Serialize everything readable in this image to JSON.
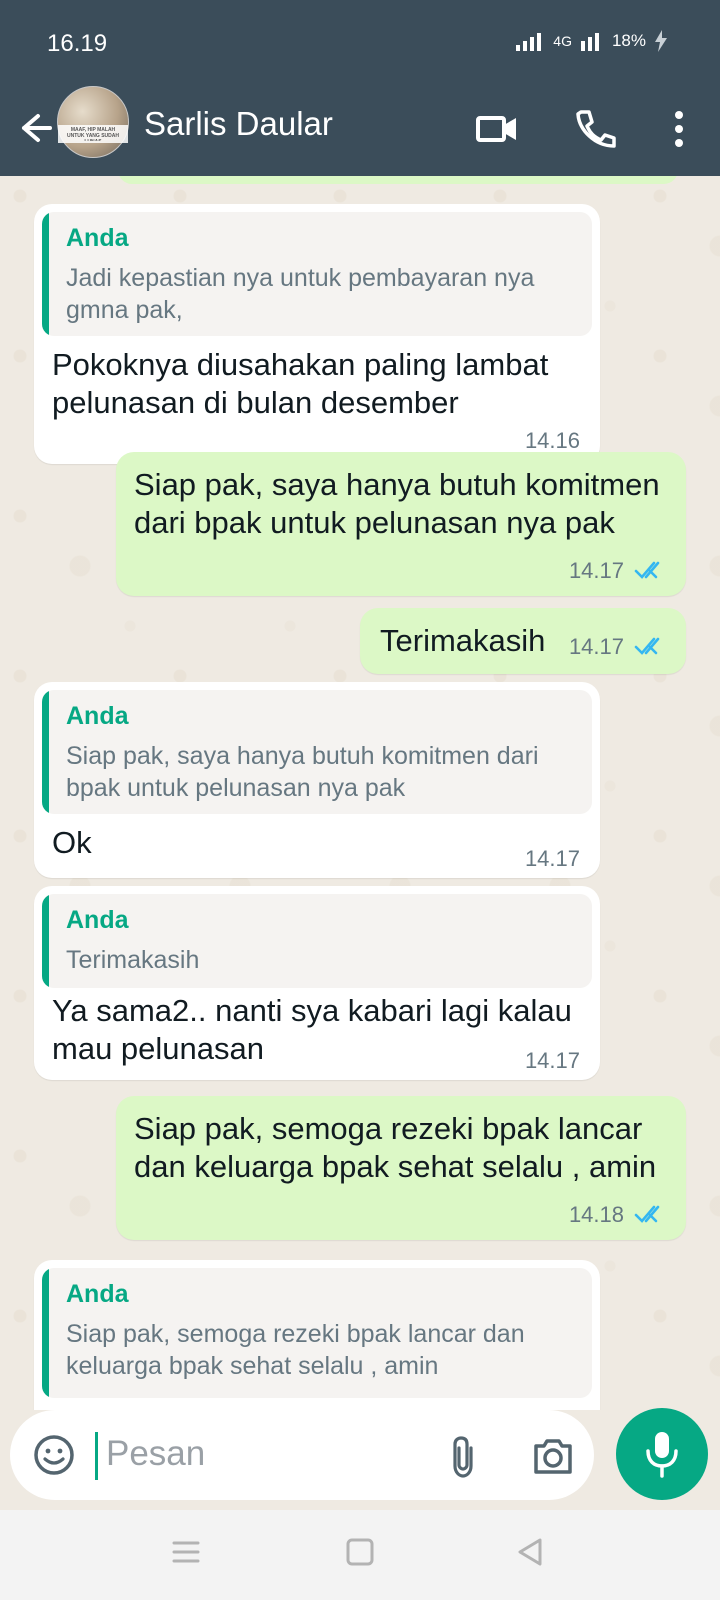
{
  "status": {
    "time": "16.19",
    "network": "4G",
    "battery": "18%"
  },
  "header": {
    "contact_name": "Sarlis Daular",
    "avatar_caption": "MAAF, HIP MALAH UNTUK YANG SUDAH LUNAS"
  },
  "messages": [
    {
      "reply_author": "Anda",
      "reply_text": "Jadi kepastian nya untuk pembayaran nya gmna pak,",
      "text": "Pokoknya diusahakan paling lambat pelunasan di bulan  desember",
      "time": "14.16"
    },
    {
      "text": "Siap pak, saya hanya butuh komitmen dari bpak untuk pelunasan nya pak",
      "time": "14.17"
    },
    {
      "text": "Terimakasih",
      "time": "14.17"
    },
    {
      "reply_author": "Anda",
      "reply_text": "Siap pak, saya hanya butuh komitmen dari bpak untuk pelunasan nya pak",
      "text": "Ok",
      "time": "14.17"
    },
    {
      "reply_author": "Anda",
      "reply_text": "Terimakasih",
      "text": "Ya sama2.. nanti sya kabari lagi kalau mau pelunasan",
      "time": "14.17"
    },
    {
      "text": "Siap pak, semoga rezeki bpak lancar dan keluarga bpak sehat selalu , amin",
      "time": "14.18"
    },
    {
      "reply_author": "Anda",
      "reply_text": "Siap pak, semoga rezeki bpak lancar dan keluarga bpak sehat selalu , amin"
    }
  ],
  "composer": {
    "placeholder": "Pesan"
  },
  "colors": {
    "header": "#3b4d5a",
    "accent": "#06a884",
    "outgoing_bubble": "#dcf8c6",
    "incoming_bubble": "#ffffff",
    "read_ticks": "#34b7f1"
  },
  "icons": {
    "back": "arrow-left-icon",
    "video": "video-icon",
    "call": "phone-icon",
    "menu": "more-vertical-icon",
    "emoji": "emoji-icon",
    "attach": "paperclip-icon",
    "camera": "camera-icon",
    "mic": "microphone-icon"
  }
}
